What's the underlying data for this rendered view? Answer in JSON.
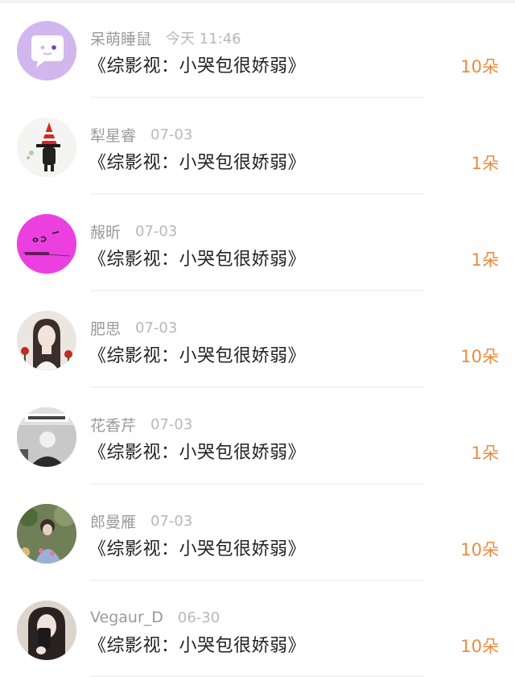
{
  "list": {
    "items": [
      {
        "name": "呆萌睡鼠",
        "time": "今天 11:46",
        "title": "《综影视：小哭包很娇弱》",
        "count": "10朵",
        "avatar": "speech-bubble-avatar",
        "avatar_color": "#d2b7ee"
      },
      {
        "name": "犁星睿",
        "time": "07-03",
        "title": "《综影视：小哭包很娇弱》",
        "count": "1朵",
        "avatar": "witch-hat-avatar",
        "avatar_color": "#f2f2f2"
      },
      {
        "name": "赧昕",
        "time": "07-03",
        "title": "《综影视：小哭包很娇弱》",
        "count": "1朵",
        "avatar": "pink-face-avatar",
        "avatar_color": "#ec3fe0"
      },
      {
        "name": "肥思",
        "time": "07-03",
        "title": "《综影视：小哭包很娇弱》",
        "count": "10朵",
        "avatar": "girl-portrait-avatar",
        "avatar_color": "#e9e2dc"
      },
      {
        "name": "花香芹",
        "time": "07-03",
        "title": "《综影视：小哭包很娇弱》",
        "count": "1朵",
        "avatar": "grayscale-photo-avatar",
        "avatar_color": "#8a8a8a"
      },
      {
        "name": "郎曼雁",
        "time": "07-03",
        "title": "《综影视：小哭包很娇弱》",
        "count": "10朵",
        "avatar": "garden-photo-avatar",
        "avatar_color": "#6a7a55"
      },
      {
        "name": "Vegaur_D",
        "time": "06-30",
        "title": "《综影视：小哭包很娇弱》",
        "count": "10朵",
        "avatar": "selfie-avatar",
        "avatar_color": "#d9cfc9"
      }
    ]
  }
}
